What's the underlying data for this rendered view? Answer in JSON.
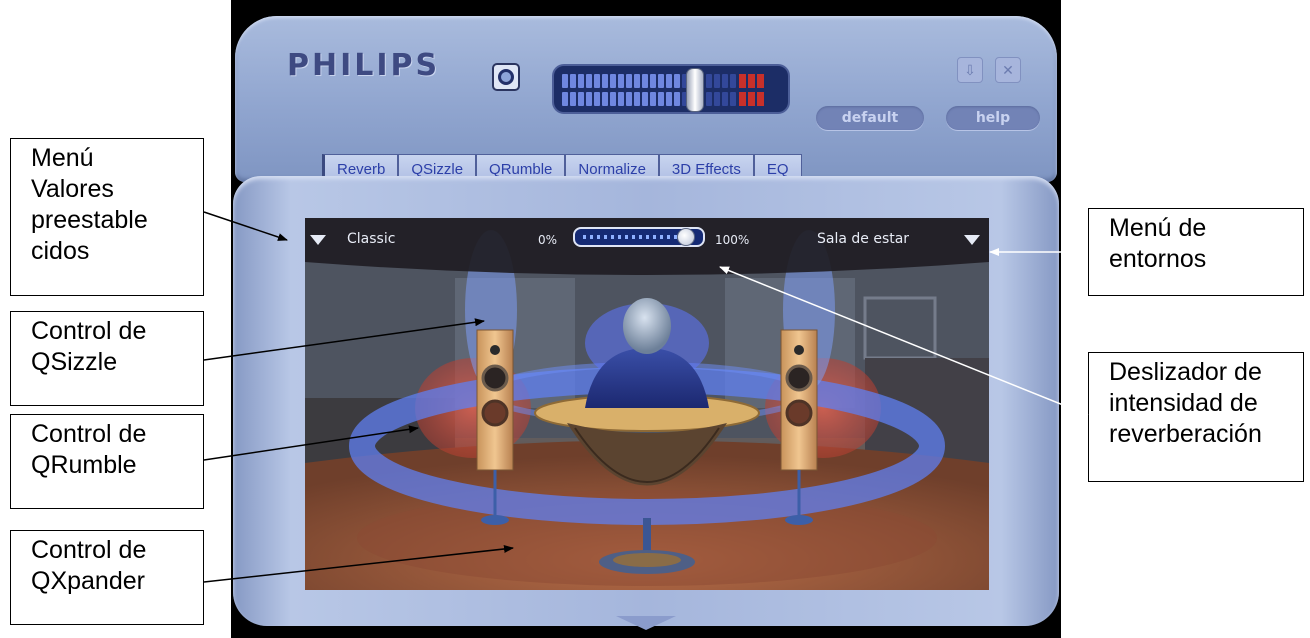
{
  "app": {
    "brand": "PHILIPS",
    "default_label": "default",
    "help_label": "help",
    "volume_level": 0.68,
    "tabs": [
      "Reverb",
      "QSizzle",
      "QRumble",
      "Normalize",
      "3D Effects",
      "EQ"
    ],
    "preset": "Classic",
    "environment": "Sala de estar",
    "reverb_min": "0%",
    "reverb_max": "100%",
    "reverb_level": 0.93,
    "colors": {
      "frame": "#a5b6dc",
      "tab_text": "#2c3fa8",
      "scene_ring": "#5f7ff0",
      "rumble_glow": "#d0584a"
    }
  },
  "callouts": {
    "presets": "Menú\nValores\npreestable\ncidos",
    "qsizzle": "Control de\nQSizzle",
    "qrumble": "Control de\nQRumble",
    "qxpander": "Control de\nQXpander",
    "environments": "Menú de\nentornos",
    "reverb": "Deslizador de\nintensidad de\nreverberación"
  },
  "icons": {
    "settings": "settings-icon",
    "minimize": "minimize-icon",
    "close": "close-icon",
    "dropdown": "triangle-down-icon"
  }
}
